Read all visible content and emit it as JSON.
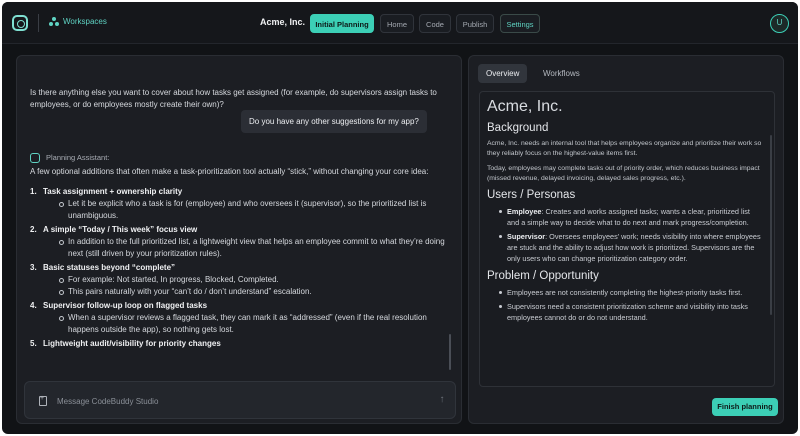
{
  "header": {
    "workspace_label": "Workspaces",
    "app_title": "Acme, Inc.",
    "tabs": [
      {
        "label": "Initial Planning"
      },
      {
        "label": "Home"
      },
      {
        "label": "Code"
      },
      {
        "label": "Publish"
      },
      {
        "label": "Settings"
      }
    ],
    "avatar_initial": "U"
  },
  "chat": {
    "assistant_question": "Is there anything else you want to cover about how tasks get assigned (for example, do supervisors assign tasks to employees, or do employees mostly create their own)?",
    "user_message": "Do you have any other suggestions for my app?",
    "assistant_name": "Planning Assistant:",
    "assistant_intro": "A few optional additions that often make a task-prioritization tool actually “stick,” without changing your core idea:",
    "items": [
      {
        "num": "1.",
        "title": "Task assignment + ownership clarity",
        "subs": [
          "Let it be explicit who a task is for (employee) and who oversees it (supervisor), so the prioritized list is unambiguous."
        ]
      },
      {
        "num": "2.",
        "title": "A simple “Today / This week” focus view",
        "subs": [
          "In addition to the full prioritized list, a lightweight view that helps an employee commit to what they’re doing next (still driven by your prioritization rules)."
        ]
      },
      {
        "num": "3.",
        "title": "Basic statuses beyond “complete”",
        "subs": [
          "For example: Not started, In progress, Blocked, Completed.",
          "This pairs naturally with your “can’t do / don’t understand” escalation."
        ]
      },
      {
        "num": "4.",
        "title": "Supervisor follow-up loop on flagged tasks",
        "subs": [
          "When a supervisor reviews a flagged task, they can mark it as “addressed” (even if the real resolution happens outside the app), so nothing gets lost."
        ]
      },
      {
        "num": "5.",
        "title": "Lightweight audit/visibility for priority changes",
        "subs": []
      }
    ],
    "composer_placeholder": "Message CodeBuddy Studio"
  },
  "doc": {
    "tabs": [
      {
        "label": "Overview"
      },
      {
        "label": "Workflows"
      }
    ],
    "title": "Acme, Inc.",
    "background_heading": "Background",
    "background_p1": "Acme, Inc. needs an internal tool that helps employees organize and prioritize their work so they reliably focus on the highest-value items first.",
    "background_p2": "Today, employees may complete tasks out of priority order, which reduces business impact (missed revenue, delayed invoicing, delayed sales progress, etc.).",
    "users_heading": "Users / Personas",
    "users": [
      {
        "role": "Employee",
        "text": ": Creates and works assigned tasks; wants a clear, prioritized list and a simple way to decide what to do next and mark progress/completion."
      },
      {
        "role": "Supervisor",
        "text": ": Oversees employees’ work; needs visibility into where employees are stuck and the ability to adjust how work is prioritized. Supervisors are the only users who can change prioritization category order."
      }
    ],
    "problem_heading": "Problem / Opportunity",
    "problems": [
      "Employees are not consistently completing the highest-priority tasks first.",
      "Supervisors need a consistent prioritization scheme and visibility into tasks employees cannot do or do not understand."
    ]
  },
  "finish_button": "Finish planning",
  "colors": {
    "accent": "#3ccfb6",
    "background": "#111316",
    "panel": "#1c1e23"
  }
}
